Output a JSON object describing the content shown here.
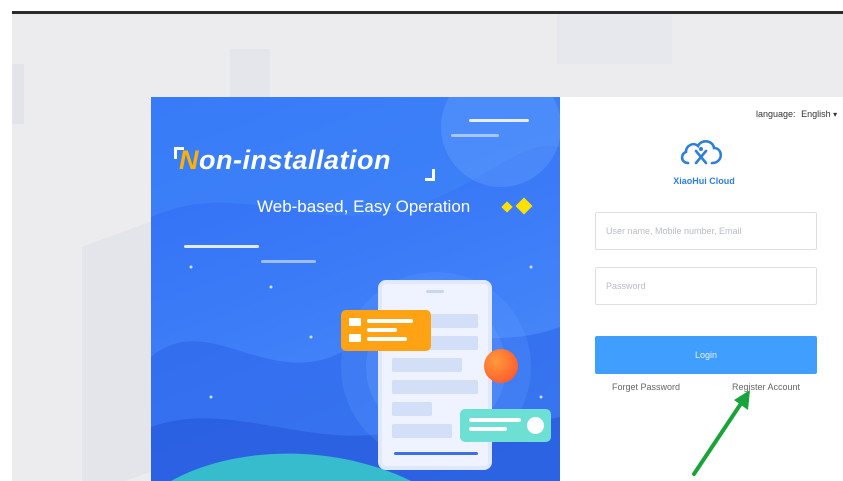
{
  "banner": {
    "headline_n": "N",
    "headline_rest": "on-installation",
    "subtitle": "Web-based, Easy Operation"
  },
  "login_panel": {
    "language_label": "language:",
    "language_value": "English",
    "brand_name": "XiaoHui Cloud",
    "username_placeholder": "User name, Mobile number, Email",
    "password_placeholder": "Password",
    "login_button": "Login",
    "forget_password": "Forget Password",
    "register_account": "Register Account"
  },
  "colors": {
    "accent": "#409eff",
    "banner_blue": "#3b7bf7",
    "annotation_arrow": "#1aa33a"
  },
  "icons": {
    "logo": "cloud-logo-icon",
    "language_dropdown": "caret-down-icon",
    "annotation": "green-arrow-icon"
  }
}
